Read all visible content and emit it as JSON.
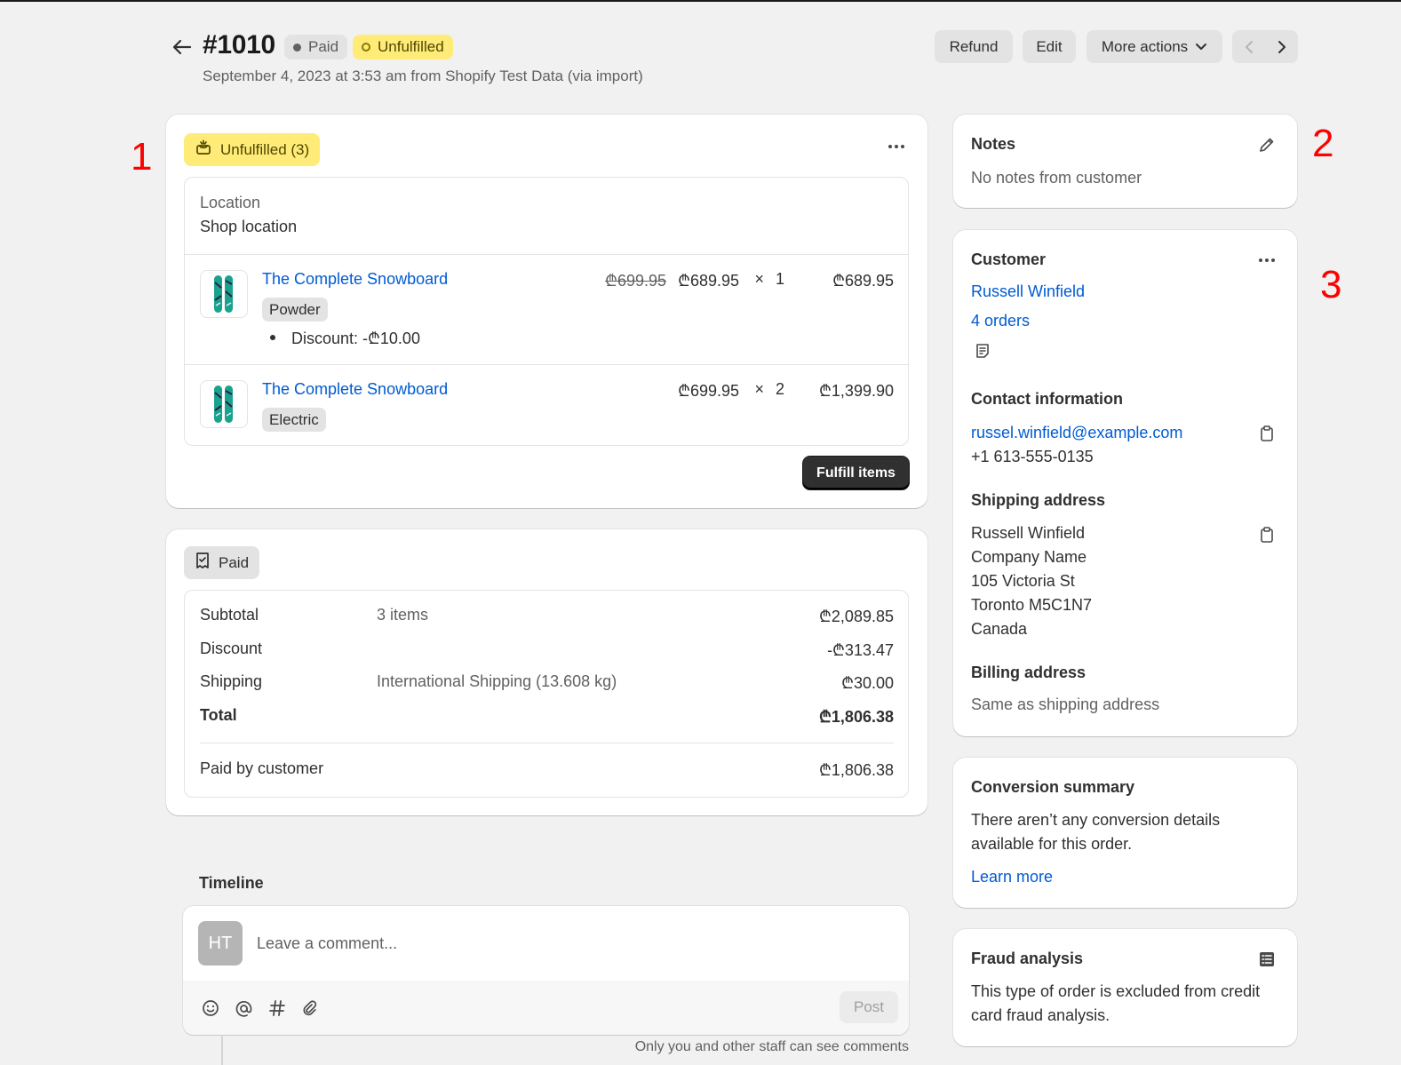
{
  "header": {
    "order_title": "#1010",
    "payment_badge": "Paid",
    "fulfillment_badge": "Unfulfilled",
    "subtitle": "September 4, 2023 at 3:53 am from Shopify Test Data (via import)",
    "refund_label": "Refund",
    "edit_label": "Edit",
    "more_actions_label": "More actions"
  },
  "fulfillment": {
    "status_label": "Unfulfilled (3)",
    "location_label": "Location",
    "location_value": "Shop location",
    "items": [
      {
        "title": "The Complete Snowboard",
        "variant": "Powder",
        "original_price": "₾699.95",
        "price": "₾689.95",
        "times": "×",
        "quantity": "1",
        "total": "₾689.95",
        "discount": "Discount: -₾10.00"
      },
      {
        "title": "The Complete Snowboard",
        "variant": "Electric",
        "price": "₾699.95",
        "times": "×",
        "quantity": "2",
        "total": "₾1,399.90"
      }
    ],
    "fulfill_button": "Fulfill items"
  },
  "payment": {
    "status_label": "Paid",
    "rows": [
      {
        "label": "Subtotal",
        "detail": "3 items",
        "amount": "₾2,089.85"
      },
      {
        "label": "Discount",
        "detail": "",
        "amount": "-₾313.47"
      },
      {
        "label": "Shipping",
        "detail": "International Shipping (13.608 kg)",
        "amount": "₾30.00"
      },
      {
        "label": "Total",
        "detail": "",
        "amount": "₾1,806.38"
      }
    ],
    "paid_by_label": "Paid by customer",
    "paid_by_amount": "₾1,806.38"
  },
  "timeline": {
    "title": "Timeline",
    "avatar_initials": "HT",
    "comment_placeholder": "Leave a comment...",
    "post_label": "Post",
    "staff_note": "Only you and other staff can see comments"
  },
  "notes": {
    "title": "Notes",
    "text": "No notes from customer"
  },
  "customer": {
    "title": "Customer",
    "name": "Russell Winfield",
    "orders": "4 orders",
    "contact_title": "Contact information",
    "email": "russel.winfield@example.com",
    "phone": "+1 613-555-0135",
    "shipping_title": "Shipping address",
    "shipping_lines": [
      "Russell Winfield",
      "Company Name",
      "105 Victoria St",
      "Toronto M5C1N7",
      "Canada"
    ],
    "billing_title": "Billing address",
    "billing_text": "Same as shipping address"
  },
  "conversion": {
    "title": "Conversion summary",
    "text_line1": "There aren’t any conversion details",
    "text_line2": "available for this order.",
    "link": "Learn more"
  },
  "fraud": {
    "title": "Fraud analysis",
    "text_line1": "This type of order is excluded from credit",
    "text_line2": "card fraud analysis."
  },
  "annotations": [
    "1",
    "2",
    "3"
  ],
  "colors": {
    "link": "#005bd3",
    "unfulfilled_bg": "#ffeb78",
    "annotation": "#ff0000",
    "background": "#f1f1f1"
  }
}
